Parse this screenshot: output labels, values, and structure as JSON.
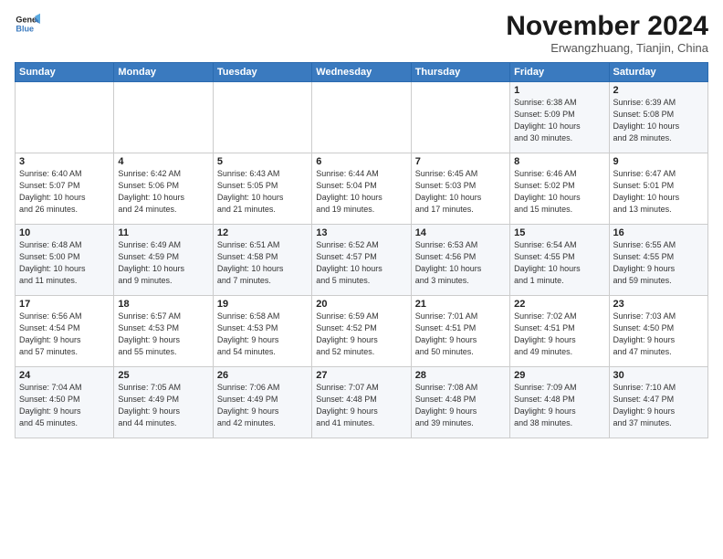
{
  "logo": {
    "line1": "General",
    "line2": "Blue"
  },
  "title": "November 2024",
  "subtitle": "Erwangzhuang, Tianjin, China",
  "weekdays": [
    "Sunday",
    "Monday",
    "Tuesday",
    "Wednesday",
    "Thursday",
    "Friday",
    "Saturday"
  ],
  "weeks": [
    [
      {
        "day": "",
        "info": ""
      },
      {
        "day": "",
        "info": ""
      },
      {
        "day": "",
        "info": ""
      },
      {
        "day": "",
        "info": ""
      },
      {
        "day": "",
        "info": ""
      },
      {
        "day": "1",
        "info": "Sunrise: 6:38 AM\nSunset: 5:09 PM\nDaylight: 10 hours\nand 30 minutes."
      },
      {
        "day": "2",
        "info": "Sunrise: 6:39 AM\nSunset: 5:08 PM\nDaylight: 10 hours\nand 28 minutes."
      }
    ],
    [
      {
        "day": "3",
        "info": "Sunrise: 6:40 AM\nSunset: 5:07 PM\nDaylight: 10 hours\nand 26 minutes."
      },
      {
        "day": "4",
        "info": "Sunrise: 6:42 AM\nSunset: 5:06 PM\nDaylight: 10 hours\nand 24 minutes."
      },
      {
        "day": "5",
        "info": "Sunrise: 6:43 AM\nSunset: 5:05 PM\nDaylight: 10 hours\nand 21 minutes."
      },
      {
        "day": "6",
        "info": "Sunrise: 6:44 AM\nSunset: 5:04 PM\nDaylight: 10 hours\nand 19 minutes."
      },
      {
        "day": "7",
        "info": "Sunrise: 6:45 AM\nSunset: 5:03 PM\nDaylight: 10 hours\nand 17 minutes."
      },
      {
        "day": "8",
        "info": "Sunrise: 6:46 AM\nSunset: 5:02 PM\nDaylight: 10 hours\nand 15 minutes."
      },
      {
        "day": "9",
        "info": "Sunrise: 6:47 AM\nSunset: 5:01 PM\nDaylight: 10 hours\nand 13 minutes."
      }
    ],
    [
      {
        "day": "10",
        "info": "Sunrise: 6:48 AM\nSunset: 5:00 PM\nDaylight: 10 hours\nand 11 minutes."
      },
      {
        "day": "11",
        "info": "Sunrise: 6:49 AM\nSunset: 4:59 PM\nDaylight: 10 hours\nand 9 minutes."
      },
      {
        "day": "12",
        "info": "Sunrise: 6:51 AM\nSunset: 4:58 PM\nDaylight: 10 hours\nand 7 minutes."
      },
      {
        "day": "13",
        "info": "Sunrise: 6:52 AM\nSunset: 4:57 PM\nDaylight: 10 hours\nand 5 minutes."
      },
      {
        "day": "14",
        "info": "Sunrise: 6:53 AM\nSunset: 4:56 PM\nDaylight: 10 hours\nand 3 minutes."
      },
      {
        "day": "15",
        "info": "Sunrise: 6:54 AM\nSunset: 4:55 PM\nDaylight: 10 hours\nand 1 minute."
      },
      {
        "day": "16",
        "info": "Sunrise: 6:55 AM\nSunset: 4:55 PM\nDaylight: 9 hours\nand 59 minutes."
      }
    ],
    [
      {
        "day": "17",
        "info": "Sunrise: 6:56 AM\nSunset: 4:54 PM\nDaylight: 9 hours\nand 57 minutes."
      },
      {
        "day": "18",
        "info": "Sunrise: 6:57 AM\nSunset: 4:53 PM\nDaylight: 9 hours\nand 55 minutes."
      },
      {
        "day": "19",
        "info": "Sunrise: 6:58 AM\nSunset: 4:53 PM\nDaylight: 9 hours\nand 54 minutes."
      },
      {
        "day": "20",
        "info": "Sunrise: 6:59 AM\nSunset: 4:52 PM\nDaylight: 9 hours\nand 52 minutes."
      },
      {
        "day": "21",
        "info": "Sunrise: 7:01 AM\nSunset: 4:51 PM\nDaylight: 9 hours\nand 50 minutes."
      },
      {
        "day": "22",
        "info": "Sunrise: 7:02 AM\nSunset: 4:51 PM\nDaylight: 9 hours\nand 49 minutes."
      },
      {
        "day": "23",
        "info": "Sunrise: 7:03 AM\nSunset: 4:50 PM\nDaylight: 9 hours\nand 47 minutes."
      }
    ],
    [
      {
        "day": "24",
        "info": "Sunrise: 7:04 AM\nSunset: 4:50 PM\nDaylight: 9 hours\nand 45 minutes."
      },
      {
        "day": "25",
        "info": "Sunrise: 7:05 AM\nSunset: 4:49 PM\nDaylight: 9 hours\nand 44 minutes."
      },
      {
        "day": "26",
        "info": "Sunrise: 7:06 AM\nSunset: 4:49 PM\nDaylight: 9 hours\nand 42 minutes."
      },
      {
        "day": "27",
        "info": "Sunrise: 7:07 AM\nSunset: 4:48 PM\nDaylight: 9 hours\nand 41 minutes."
      },
      {
        "day": "28",
        "info": "Sunrise: 7:08 AM\nSunset: 4:48 PM\nDaylight: 9 hours\nand 39 minutes."
      },
      {
        "day": "29",
        "info": "Sunrise: 7:09 AM\nSunset: 4:48 PM\nDaylight: 9 hours\nand 38 minutes."
      },
      {
        "day": "30",
        "info": "Sunrise: 7:10 AM\nSunset: 4:47 PM\nDaylight: 9 hours\nand 37 minutes."
      }
    ]
  ]
}
